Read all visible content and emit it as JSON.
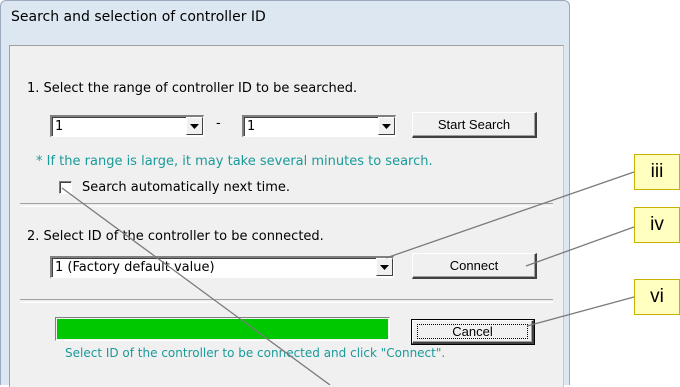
{
  "dialog": {
    "title": "Search and selection of controller ID",
    "step1_label": "1. Select the range of controller ID to be searched.",
    "range_from": "1",
    "range_separator": "-",
    "range_to": "1",
    "start_search_label": "Start Search",
    "hint": "* If the range is large, it may take several minutes to search.",
    "auto_search_label": "Search automatically next time.",
    "auto_search_checked": false,
    "step2_label": "2. Select ID of the controller to be connected.",
    "controller_id": "1 (Factory default value)",
    "connect_label": "Connect",
    "progress_fraction": 1.0,
    "progress_color": "#00c800",
    "cancel_label": "Cancel",
    "status_text": "Select ID of the controller to be connected and click \"Connect\"."
  },
  "callouts": [
    "iii",
    "iv",
    "vi"
  ],
  "colors": {
    "hint_text": "#1a9a9a",
    "callout_fill": "#ffffc0",
    "callout_border": "#c8b000",
    "leader_line": "#7a7a7a"
  }
}
